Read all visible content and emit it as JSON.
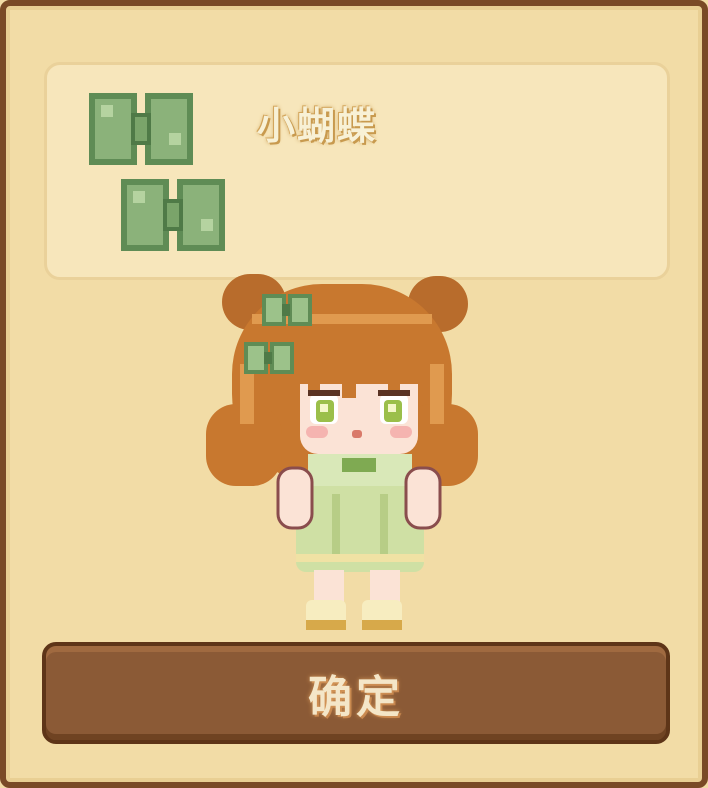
{
  "item": {
    "name": "小蝴蝶",
    "icon": "green-bow-hairpin-icon"
  },
  "character": {
    "icon": "chibi-character-avatar",
    "hair_color": "#c8782f",
    "outfit_color": "#cfe0a4",
    "bow_color": "#6aa26a"
  },
  "buttons": {
    "confirm_label": "确定"
  },
  "colors": {
    "panel_bg": "#f2dca6",
    "panel_border": "#7a4a26",
    "button_bg": "#8b5a36",
    "item_box_bg": "#f7e6bb"
  }
}
